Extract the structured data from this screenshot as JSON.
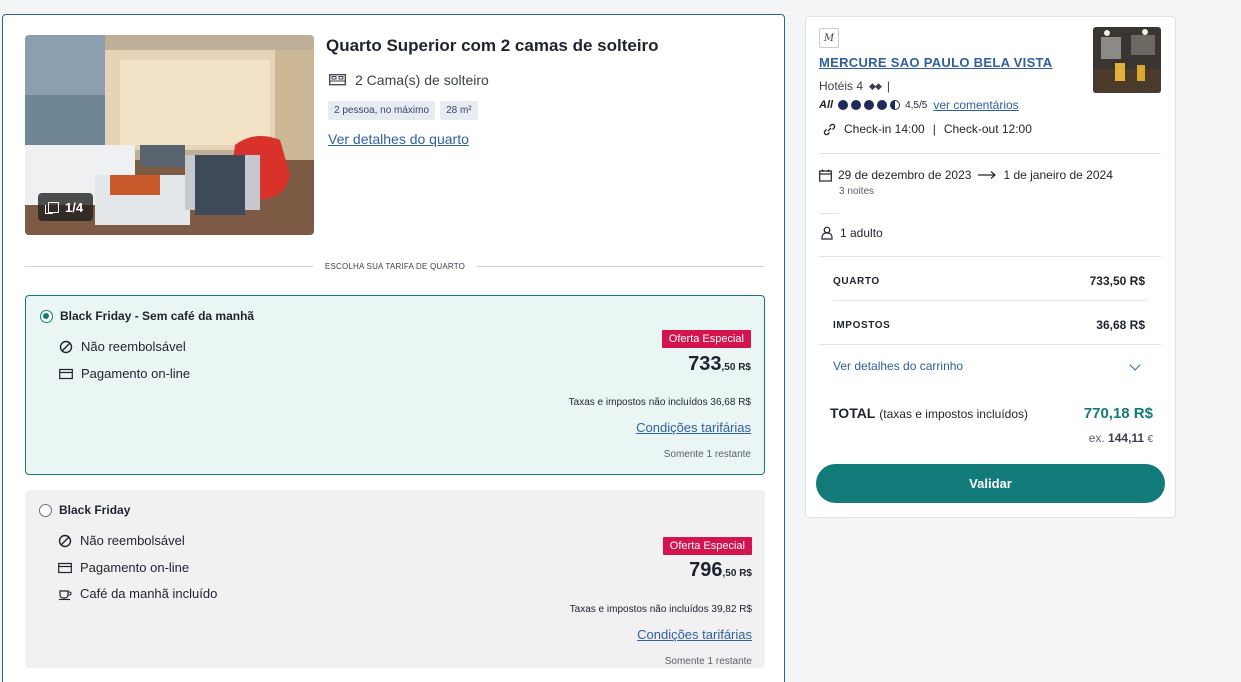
{
  "room": {
    "title": "Quarto Superior com 2 camas de solteiro",
    "bed": "2 Cama(s) de solteiro",
    "chips": [
      "2 pessoa, no máximo",
      "28 m²"
    ],
    "details_link": "Ver detalhes do quarto",
    "photo_counter": "1/4"
  },
  "rate_section_label": "ESCOLHA SUA TARIFA DE QUARTO",
  "rates": [
    {
      "name": "Black Friday - Sem café da manhã",
      "selected": true,
      "features": [
        "Não reembolsável",
        "Pagamento on-line"
      ],
      "offer": "Oferta Especial",
      "price_int": "733",
      "price_dec": ",50 R$",
      "taxes": "Taxas e impostos não incluídos 36,68 R$",
      "conditions": "Condições tarifárias",
      "remaining": "Somente 1 restante"
    },
    {
      "name": "Black Friday",
      "selected": false,
      "features": [
        "Não reembolsável",
        "Pagamento on-line",
        "Café da manhã incluído"
      ],
      "offer": "Oferta Especial",
      "price_int": "796",
      "price_dec": ",50 R$",
      "taxes": "Taxas e impostos não incluídos 39,82 R$",
      "conditions": "Condições tarifárias",
      "remaining": "Somente 1 restante"
    }
  ],
  "summary": {
    "hotel_name": "MERCURE SAO PAULO BELA VISTA",
    "category": "Hotéis 4",
    "category_sep": "|",
    "all_logo": "All",
    "rating_score": "4,5/5",
    "reviews_link": "ver comentários",
    "rating_value": 4.5,
    "checkin": "Check-in 14:00",
    "checkin_sep": "|",
    "checkout": "Check-out 12:00",
    "date_from": "29 de dezembro de 2023",
    "date_to": "1 de janeiro de 2024",
    "nights": "3 noites",
    "guests": "1 adulto",
    "room_label": "QUARTO",
    "room_value": "733,50 R$",
    "taxes_label": "IMPOSTOS",
    "taxes_value": "36,68 R$",
    "cart_link": "Ver detalhes do carrinho",
    "total_label": "TOTAL",
    "total_note": "(taxas e impostos incluídos)",
    "total_value": "770,18 R$",
    "total_ex_prefix": "ex.",
    "total_ex_value": "144,11",
    "total_ex_currency": "€",
    "validate": "Validar"
  },
  "colors": {
    "accent": "#127a78",
    "link": "#2f5f9e",
    "offer": "#d4144f",
    "selected_bg": "#eaf6f4"
  },
  "icons": [
    "bed-icon",
    "no-refund-icon",
    "card-icon",
    "coffee-icon",
    "gallery-icon",
    "link-icon",
    "calendar-icon",
    "arrow-right-icon",
    "person-icon",
    "chevron-down-icon",
    "brand-logo-icon"
  ]
}
